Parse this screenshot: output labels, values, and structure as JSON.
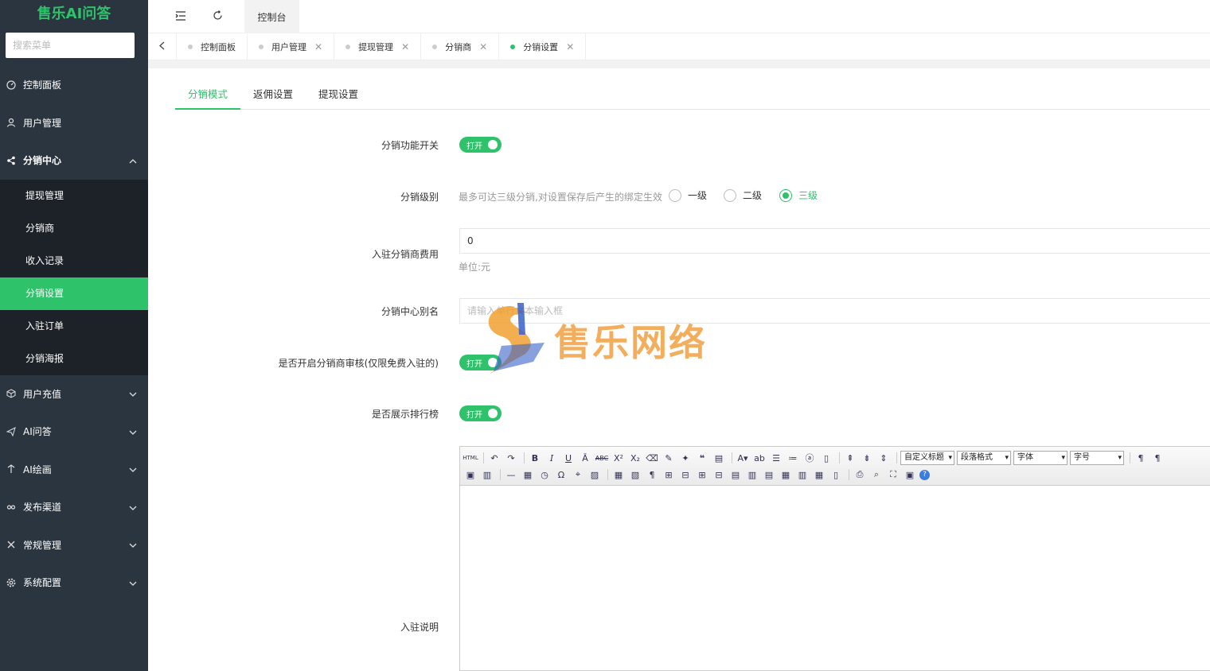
{
  "app": {
    "title": "售乐AI问答"
  },
  "sidebar": {
    "search_placeholder": "搜索菜单",
    "items": [
      {
        "label": "控制面板"
      },
      {
        "label": "用户管理"
      },
      {
        "label": "分销中心"
      },
      {
        "label": "用户充值"
      },
      {
        "label": "AI问答"
      },
      {
        "label": "AI绘画"
      },
      {
        "label": "发布渠道"
      },
      {
        "label": "常规管理"
      },
      {
        "label": "系统配置"
      }
    ],
    "subitems": [
      {
        "label": "提现管理"
      },
      {
        "label": "分销商"
      },
      {
        "label": "收入记录"
      },
      {
        "label": "分销设置"
      },
      {
        "label": "入驻订单"
      },
      {
        "label": "分销海报"
      }
    ]
  },
  "topbar": {
    "tab_label": "控制台"
  },
  "tabs": [
    {
      "label": "控制面板"
    },
    {
      "label": "用户管理"
    },
    {
      "label": "提现管理"
    },
    {
      "label": "分销商"
    },
    {
      "label": "分销设置"
    }
  ],
  "form_tabs": [
    {
      "label": "分销模式"
    },
    {
      "label": "返佣设置"
    },
    {
      "label": "提现设置"
    }
  ],
  "form": {
    "switch_label": "分销功能开关",
    "switch_text": "打开",
    "level_label": "分销级别",
    "level_hint": "最多可达三级分销,对设置保存后产生的绑定生效",
    "level_options": [
      "一级",
      "二级",
      "三级"
    ],
    "level_selected": "三级",
    "fee_label": "入驻分销商费用",
    "fee_value": "0",
    "fee_unit": "单位:元",
    "alias_label": "分销中心别名",
    "alias_placeholder": "请输入单行文本输入框",
    "audit_label": "是否开启分销商审核(仅限免费入驻的)",
    "audit_text": "打开",
    "rank_label": "是否展示排行榜",
    "rank_text": "打开",
    "desc_label": "入驻说明"
  },
  "editor": {
    "selects": [
      "自定义标题",
      "段落格式",
      "字体",
      "字号"
    ]
  },
  "watermark": {
    "text": "售乐网络"
  },
  "colors": {
    "accent": "#2ec26b",
    "sidebar": "#2b353f",
    "submenu": "#1c2228"
  }
}
